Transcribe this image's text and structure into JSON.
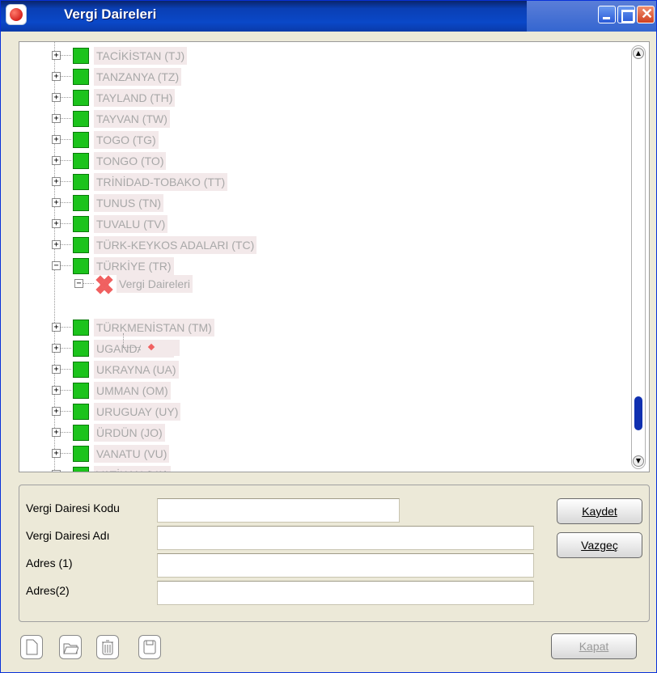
{
  "window": {
    "title": "Vergi Daireleri"
  },
  "tree": {
    "nodes": [
      {
        "label": "TACİKİSTAN (TJ)",
        "expander": "+"
      },
      {
        "label": "TANZANYA (TZ)",
        "expander": "+"
      },
      {
        "label": "TAYLAND (TH)",
        "expander": "+"
      },
      {
        "label": "TAYVAN (TW)",
        "expander": "+"
      },
      {
        "label": "TOGO (TG)",
        "expander": "+"
      },
      {
        "label": "TONGO (TO)",
        "expander": "+"
      },
      {
        "label": "TRİNİDAD-TOBAKO (TT)",
        "expander": "+"
      },
      {
        "label": "TUNUS (TN)",
        "expander": "+"
      },
      {
        "label": "TUVALU (TV)",
        "expander": "+"
      },
      {
        "label": "TÜRK-KEYKOS ADALARI (TC)",
        "expander": "+"
      },
      {
        "label": "TÜRKİYE (TR)",
        "expander": "−"
      },
      {
        "label": "TÜRKMENİSTAN (TM)",
        "expander": "+"
      },
      {
        "label": "UGANDA (UG)",
        "expander": "+"
      },
      {
        "label": "UKRAYNA (UA)",
        "expander": "+"
      },
      {
        "label": "UMMAN (OM)",
        "expander": "+"
      },
      {
        "label": "URUGUAY (UY)",
        "expander": "+"
      },
      {
        "label": "ÜRDÜN (JO)",
        "expander": "+"
      },
      {
        "label": "VANATU (VU)",
        "expander": "+"
      },
      {
        "label": "VATİKAN (VA)",
        "expander": "+"
      }
    ],
    "child": {
      "label": "Vergi Daireleri",
      "expander": "−"
    },
    "scroll_position": 0.85
  },
  "form": {
    "code_label": "Vergi Dairesi Kodu",
    "code_value": "",
    "name_label": "Vergi Dairesi Adı",
    "name_value": "",
    "address1_label": "Adres (1)",
    "address1_value": "",
    "address2_label": "Adres(2)",
    "address2_value": ""
  },
  "buttons": {
    "save": "Kaydet",
    "cancel": "Vazgeç",
    "close": "Kapat"
  },
  "toolbar": {
    "icons": [
      "new-document-icon",
      "open-folder-icon",
      "trash-icon",
      "save-disk-icon"
    ]
  },
  "colors": {
    "title_bar": "#0a48c8",
    "node_icon": "#1cc31c",
    "label_bg": "#f3e9ea",
    "diamond": "#f06060"
  }
}
